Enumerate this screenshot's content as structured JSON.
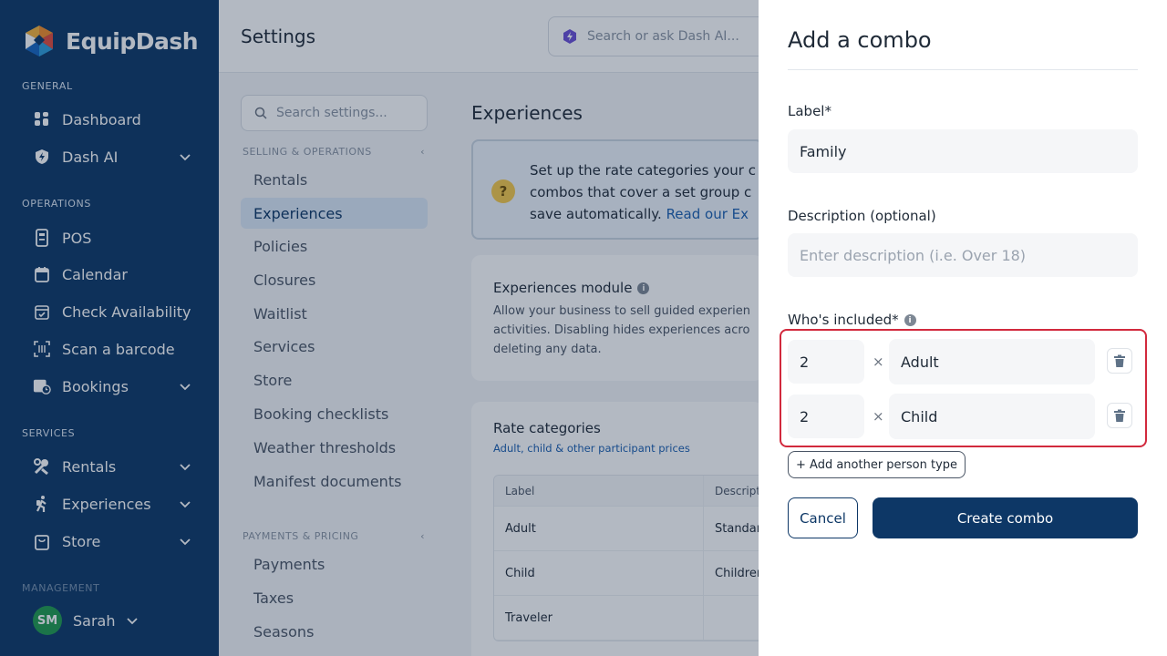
{
  "sidebar": {
    "brand": "EquipDash",
    "sections": [
      "GENERAL",
      "OPERATIONS",
      "SERVICES",
      "MANAGEMENT"
    ],
    "items": [
      {
        "label": "Dashboard",
        "icon": "grid-icon"
      },
      {
        "label": "Dash AI",
        "icon": "shield-bolt-icon"
      },
      {
        "label": "POS",
        "icon": "receipt-icon"
      },
      {
        "label": "Calendar",
        "icon": "calendar-icon"
      },
      {
        "label": "Check Availability",
        "icon": "calendar-check-icon"
      },
      {
        "label": "Scan a barcode",
        "icon": "barcode-icon"
      },
      {
        "label": "Bookings",
        "icon": "calendar-clock-icon"
      },
      {
        "label": "Rentals",
        "icon": "tools-icon"
      },
      {
        "label": "Experiences",
        "icon": "hiker-icon"
      },
      {
        "label": "Store",
        "icon": "bag-icon"
      }
    ],
    "profile": {
      "initials": "SM",
      "name": "Sarah"
    }
  },
  "topbar": {
    "title": "Settings",
    "search_placeholder": "Search or ask Dash AI..."
  },
  "settings_nav": {
    "search_placeholder": "Search settings...",
    "group1": "SELLING & OPERATIONS",
    "group1_items": [
      "Rentals",
      "Experiences",
      "Policies",
      "Closures",
      "Waitlist",
      "Services",
      "Store",
      "Booking checklists",
      "Weather thresholds",
      "Manifest documents"
    ],
    "group2": "PAYMENTS & PRICING",
    "group2_items": [
      "Payments",
      "Taxes",
      "Seasons"
    ]
  },
  "content": {
    "title": "Experiences",
    "banner_line1": "Set up the rate categories your c",
    "banner_line2": "combos that cover a set group c",
    "banner_line3": "save automatically.",
    "banner_link": "Read our Ex",
    "module_title": "Experiences module",
    "module_line1": "Allow your business to sell guided experien",
    "module_line2": "activities. Disabling hides experiences acro",
    "module_line3": "deleting any data.",
    "rates_title": "Rate categories",
    "rates_subtitle": "Adult, child & other participant prices",
    "table_headers": [
      "Label",
      "Descript"
    ],
    "table_rows": [
      [
        "Adult",
        "Standar"
      ],
      [
        "Child",
        "Children"
      ],
      [
        "Traveler",
        ""
      ]
    ]
  },
  "drawer": {
    "title": "Add a combo",
    "label_field": "Label*",
    "label_value": "Family",
    "description_field": "Description (optional)",
    "description_placeholder": "Enter description (i.e. Over 18)",
    "included_field": "Who's included*",
    "persons": [
      {
        "qty": "2",
        "type": "Adult"
      },
      {
        "qty": "2",
        "type": "Child"
      }
    ],
    "times_symbol": "×",
    "add_person": "+ Add another person type",
    "cancel": "Cancel",
    "create": "Create combo"
  },
  "colors": {
    "sidebar_bg": "#0d3766",
    "primary": "#0d3766",
    "highlight_border": "#d2293d",
    "avatar": "#1f9a4d"
  }
}
